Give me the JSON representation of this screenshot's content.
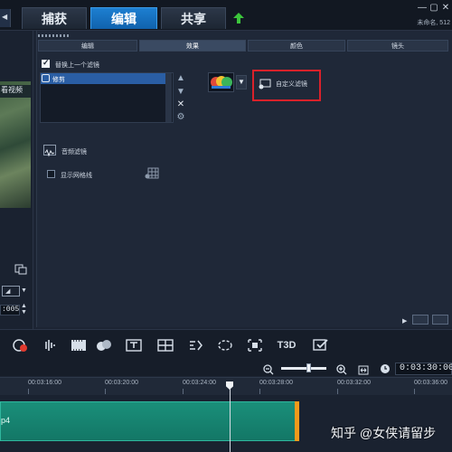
{
  "header": {
    "tabs": [
      {
        "label": "捕获",
        "active": false
      },
      {
        "label": "编辑",
        "active": true
      },
      {
        "label": "共享",
        "active": false
      }
    ],
    "window_controls": [
      "—",
      "▢",
      "✕"
    ],
    "project_title": "未命名, 512"
  },
  "preview": {
    "thumb_label": "看视频"
  },
  "options": {
    "subtabs": [
      "编辑",
      "效果",
      "颜色",
      "镜头"
    ],
    "active_subtab": "效果",
    "replace_last_filter_label": "替换上一个滤镜",
    "replace_last_filter_checked": true,
    "filter_list": [
      "修剪"
    ],
    "custom_filter_label": "自定义滤镜",
    "audio_filter_label": "音频滤镜",
    "show_grid_label": "显示网格线",
    "show_grid_checked": false,
    "side_controls": [
      "▲",
      "▼",
      "✕",
      "⚙"
    ]
  },
  "toolbar": {
    "tools": [
      "record-icon",
      "audio-mixer-icon",
      "film-strip-icon",
      "paint-icon",
      "title-icon",
      "grid-icon",
      "motion-icon",
      "mask-icon",
      "crop-icon",
      "3d-title-icon",
      "check-icon"
    ],
    "tool_3d_label": "T3D"
  },
  "timeline": {
    "timecode": "0:03:30:00",
    "ticks": [
      "00:03:16:00",
      "00:03:20:00",
      "00:03:24:00",
      "00:03:28:00",
      "00:03:32:00",
      "00:03:36:00"
    ],
    "clip_label": "p4",
    "zoom_level": 0.6
  },
  "watermark": "知乎 @女侠请留步",
  "colors": {
    "accent": "#1670c4",
    "clip": "#178471",
    "highlight": "#d9212a"
  }
}
